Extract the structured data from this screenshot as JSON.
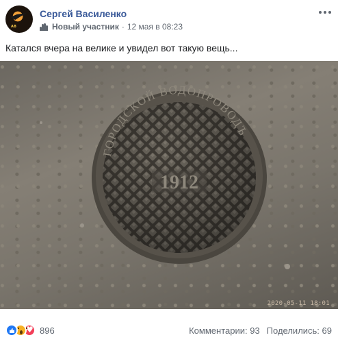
{
  "post": {
    "author": "Сергей Василенко",
    "avatar_text": "AB",
    "badge": "Новый участник",
    "separator": "·",
    "date": "12 мая в 08:23",
    "text": "Катался вчера на велике и увидел вот такую вещь...",
    "photo": {
      "cover_inscription": "ГОРОДСКОЙ ВОДОПРОВОДЪ",
      "cover_year": "1912",
      "timestamp": "2020-05-11 18:01"
    },
    "reactions": {
      "icons": [
        "like-icon",
        "wow-icon",
        "love-icon"
      ],
      "count": "896"
    },
    "comments": "Комментарии: 93",
    "shares": "Поделились: 69"
  },
  "colors": {
    "author_link": "#385898",
    "meta_text": "#606770",
    "like": "#2078f4",
    "wow": "#f7b125",
    "love": "#f33e58"
  }
}
